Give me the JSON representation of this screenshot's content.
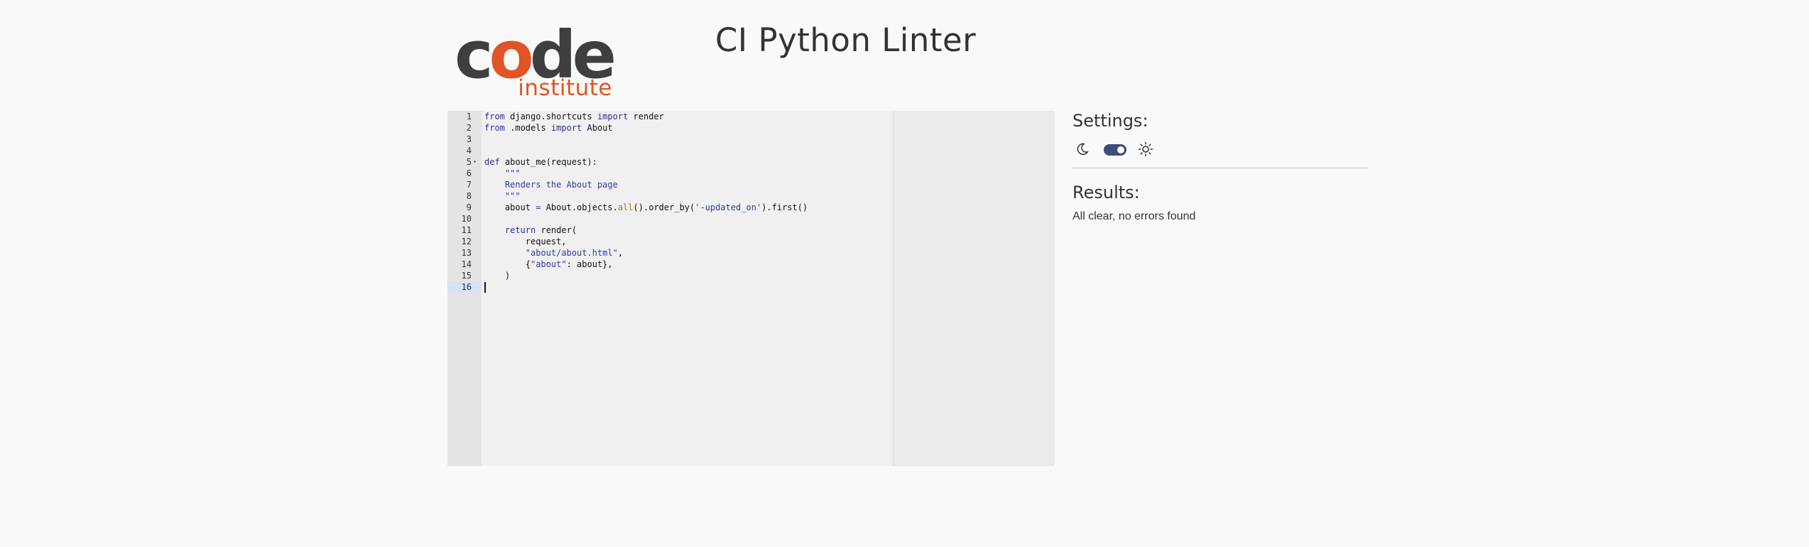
{
  "logo": {
    "word_c": "c",
    "word_o": "o",
    "word_de": "de",
    "sub": "institute"
  },
  "header": {
    "title": "CI Python Linter"
  },
  "editor": {
    "lines": [
      {
        "n": "1",
        "tokens": [
          {
            "t": "from",
            "c": "kw"
          },
          {
            "t": " django.shortcuts ",
            "c": ""
          },
          {
            "t": "import",
            "c": "kw"
          },
          {
            "t": " render",
            "c": ""
          }
        ]
      },
      {
        "n": "2",
        "tokens": [
          {
            "t": "from",
            "c": "kw"
          },
          {
            "t": " .models ",
            "c": ""
          },
          {
            "t": "import",
            "c": "kw"
          },
          {
            "t": " About",
            "c": ""
          }
        ]
      },
      {
        "n": "3",
        "tokens": []
      },
      {
        "n": "4",
        "tokens": []
      },
      {
        "n": "5",
        "fold": true,
        "tokens": [
          {
            "t": "def",
            "c": "kw"
          },
          {
            "t": " about_me(request):",
            "c": ""
          }
        ]
      },
      {
        "n": "6",
        "tokens": [
          {
            "t": "    \"\"\"",
            "c": "str"
          }
        ]
      },
      {
        "n": "7",
        "tokens": [
          {
            "t": "    Renders the About page",
            "c": "str"
          }
        ]
      },
      {
        "n": "8",
        "tokens": [
          {
            "t": "    \"\"\"",
            "c": "str"
          }
        ]
      },
      {
        "n": "9",
        "tokens": [
          {
            "t": "    about ",
            "c": ""
          },
          {
            "t": "=",
            "c": "kw"
          },
          {
            "t": " About.objects.",
            "c": ""
          },
          {
            "t": "all",
            "c": "fn"
          },
          {
            "t": "().order_by(",
            "c": ""
          },
          {
            "t": "'-updated_on'",
            "c": "str"
          },
          {
            "t": ").first()",
            "c": ""
          }
        ]
      },
      {
        "n": "10",
        "tokens": []
      },
      {
        "n": "11",
        "tokens": [
          {
            "t": "    ",
            "c": ""
          },
          {
            "t": "return",
            "c": "kw"
          },
          {
            "t": " render(",
            "c": ""
          }
        ]
      },
      {
        "n": "12",
        "tokens": [
          {
            "t": "        request,",
            "c": ""
          }
        ]
      },
      {
        "n": "13",
        "tokens": [
          {
            "t": "        ",
            "c": ""
          },
          {
            "t": "\"about/about.html\"",
            "c": "str"
          },
          {
            "t": ",",
            "c": ""
          }
        ]
      },
      {
        "n": "14",
        "tokens": [
          {
            "t": "        {",
            "c": ""
          },
          {
            "t": "\"about\"",
            "c": "str"
          },
          {
            "t": ": about},",
            "c": ""
          }
        ]
      },
      {
        "n": "15",
        "tokens": [
          {
            "t": "    )",
            "c": ""
          }
        ]
      },
      {
        "n": "16",
        "active": true,
        "tokens": []
      }
    ]
  },
  "settings": {
    "title": "Settings:",
    "dark_icon": "moon-icon",
    "light_icon": "sun-icon",
    "theme_toggle_on": true
  },
  "results": {
    "title": "Results:",
    "message": "All clear, no errors found"
  },
  "colors": {
    "brand_dark": "#3f3f3f",
    "brand_accent": "#e05426",
    "toggle": "#3b4d7a"
  }
}
